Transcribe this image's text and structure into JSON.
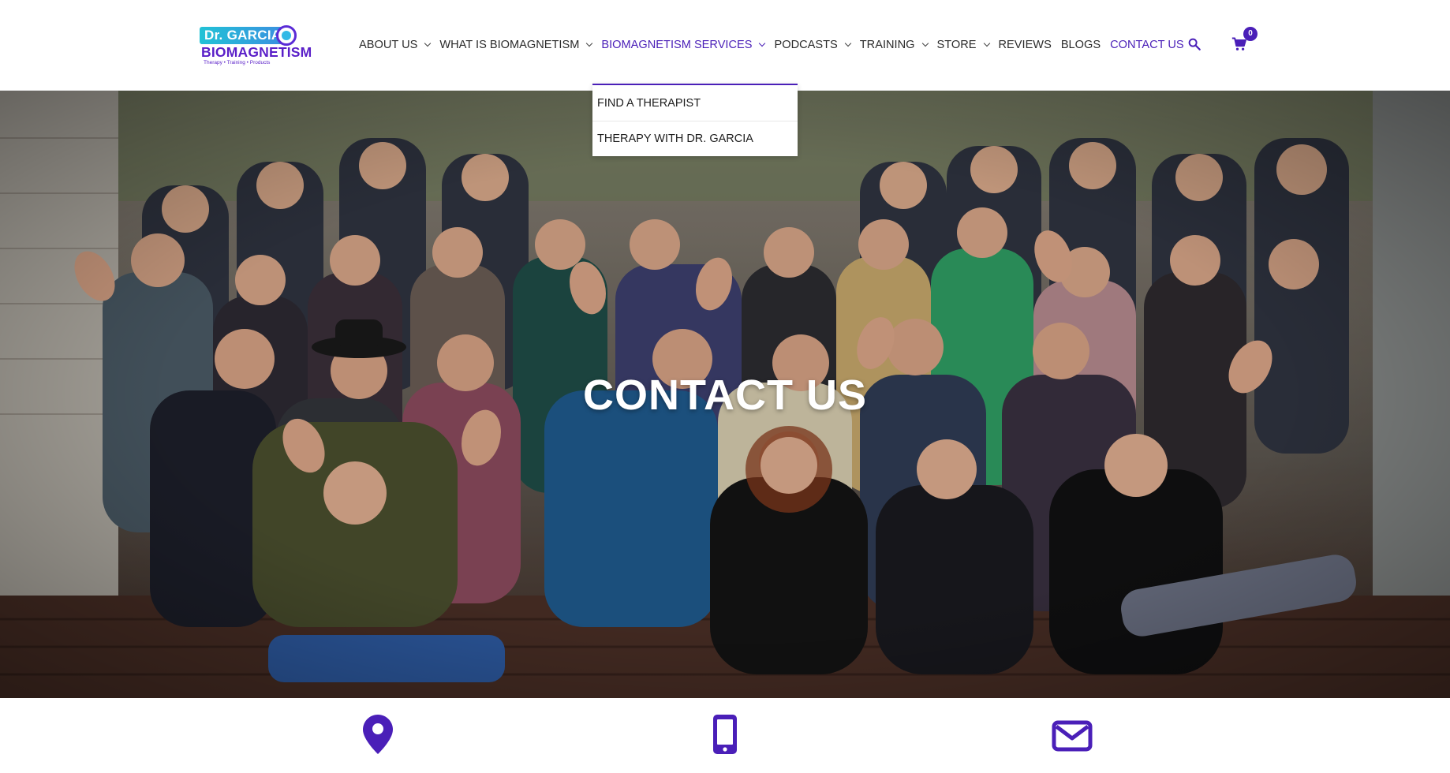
{
  "brand": {
    "line1": "Dr. GARCIA",
    "line2": "BIOMAGNETISM",
    "tagline": "Therapy • Training • Products",
    "accent": "#4a1fb8",
    "teal": "#21c2d6"
  },
  "nav": {
    "about": "ABOUT US",
    "what": "WHAT IS BIOMAGNETISM",
    "services": "BIOMAGNETISM SERVICES",
    "podcasts": "PODCASTS",
    "training": "TRAINING",
    "store": "STORE",
    "reviews": "REVIEWS",
    "blogs": "BLOGS",
    "contact": "CONTACT US"
  },
  "cart": {
    "count": "0"
  },
  "dropdown": {
    "items": [
      "FIND A THERAPIST",
      "THERAPY WITH DR. GARCIA"
    ]
  },
  "hero": {
    "title": "CONTACT US"
  },
  "icons": {
    "search": "search-icon",
    "cart": "cart-icon",
    "location": "map-pin-icon",
    "phone": "mobile-phone-icon",
    "email": "envelope-icon"
  }
}
